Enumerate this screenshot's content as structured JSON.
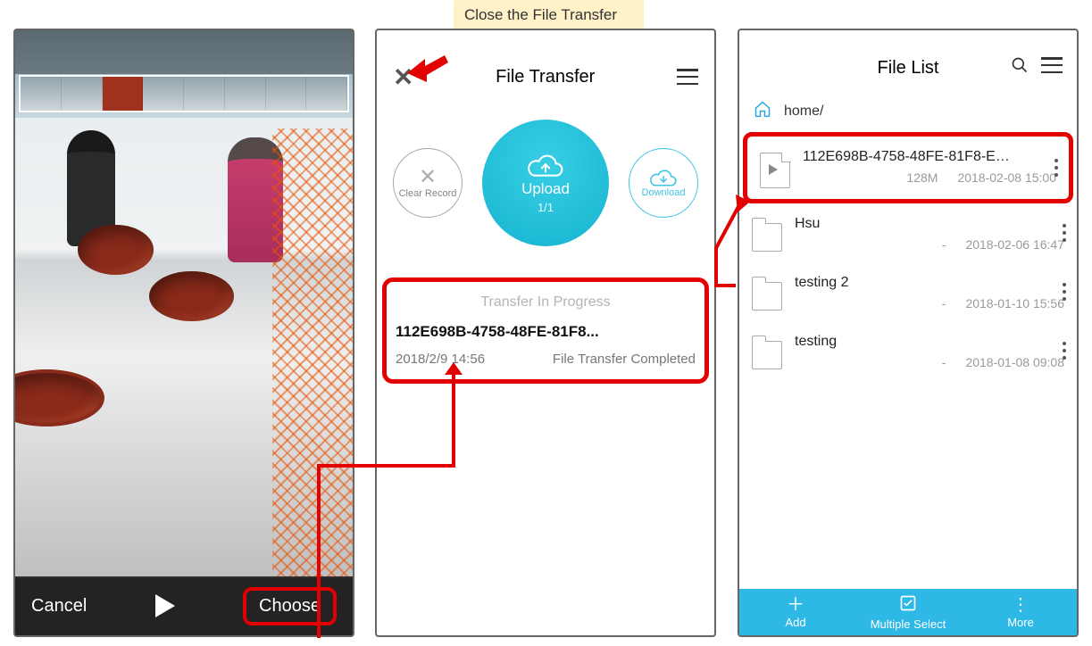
{
  "tooltip": "Close the File Transfer\nwindow to review the file.",
  "picker": {
    "cancel": "Cancel",
    "choose": "Choose"
  },
  "transfer": {
    "title": "File Transfer",
    "clear_label": "Clear Record",
    "upload_label": "Upload",
    "upload_count": "1/1",
    "download_label": "Download",
    "section_label": "Transfer In Progress",
    "file_name": "112E698B-4758-48FE-81F8...",
    "timestamp": "2018/2/9 14:56",
    "status": "File Transfer Completed"
  },
  "filelist": {
    "title": "File List",
    "breadcrumb": "home/",
    "items": [
      {
        "name": "112E698B-4758-48FE-81F8-E1E...",
        "size": "128M",
        "date": "2018-02-08 15:00",
        "type": "video"
      },
      {
        "name": "Hsu",
        "size": "-",
        "date": "2018-02-06 16:47",
        "type": "folder"
      },
      {
        "name": "testing 2",
        "size": "-",
        "date": "2018-01-10 15:56",
        "type": "folder"
      },
      {
        "name": "testing",
        "size": "-",
        "date": "2018-01-08 09:08",
        "type": "folder"
      }
    ],
    "footer": {
      "add": "Add",
      "multi": "Multiple Select",
      "more": "More"
    }
  }
}
